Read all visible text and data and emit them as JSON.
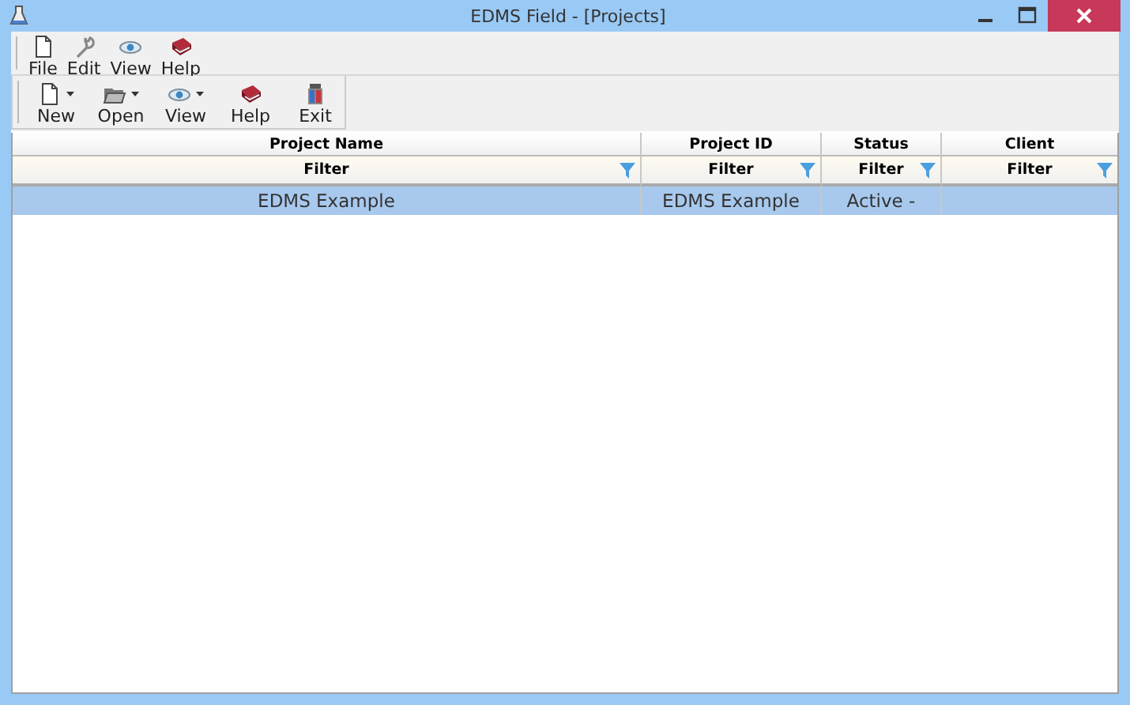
{
  "window": {
    "title": "EDMS Field - [Projects]"
  },
  "menu": [
    {
      "label": "File",
      "kind": "document"
    },
    {
      "label": "Edit",
      "kind": "wrench"
    },
    {
      "label": "View",
      "kind": "eye"
    },
    {
      "label": "Help",
      "kind": "book"
    }
  ],
  "toolbar": [
    {
      "label": "New",
      "kind": "document",
      "dropdown": true
    },
    {
      "label": "Open",
      "kind": "folder",
      "dropdown": true
    },
    {
      "label": "View",
      "kind": "eye",
      "dropdown": true
    },
    {
      "label": "Help",
      "kind": "book",
      "dropdown": false
    },
    {
      "label": "Exit",
      "kind": "exit",
      "dropdown": false
    }
  ],
  "table": {
    "columns": [
      {
        "title": "Project Name",
        "filter": "Filter"
      },
      {
        "title": "Project ID",
        "filter": "Filter"
      },
      {
        "title": "Status",
        "filter": "Filter"
      },
      {
        "title": "Client",
        "filter": "Filter"
      }
    ],
    "rows": [
      {
        "selected": true,
        "cells": [
          "EDMS Example",
          "EDMS Example",
          "Active -",
          ""
        ]
      }
    ]
  }
}
